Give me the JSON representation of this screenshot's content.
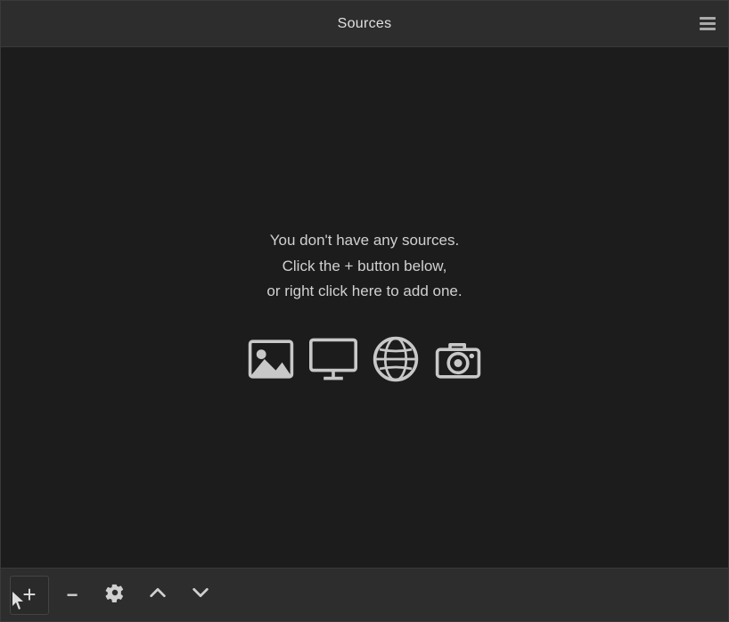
{
  "panel": {
    "title": "Sources",
    "empty_message_line1": "You don't have any sources.",
    "empty_message_line2": "Click the + button below,",
    "empty_message_line3": "or right click here to add one."
  },
  "toolbar": {
    "add_label": "+",
    "remove_label": "−",
    "settings_label": "⚙",
    "move_up_label": "∧",
    "move_down_label": "∨"
  },
  "icons": {
    "image": "image-source-icon",
    "display": "display-capture-icon",
    "browser": "browser-source-icon",
    "camera": "camera-source-icon"
  },
  "colors": {
    "background": "#1c1c1c",
    "header_bg": "#2d2d2d",
    "text": "#d0d0d0",
    "border": "#3a3a3a"
  }
}
